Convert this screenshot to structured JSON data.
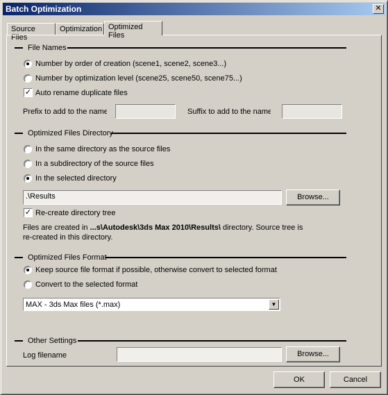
{
  "window": {
    "title": "Batch Optimization",
    "close_glyph": "✕"
  },
  "tabs": [
    {
      "label": "Source Files"
    },
    {
      "label": "Optimization"
    },
    {
      "label": "Optimized Files"
    }
  ],
  "file_names": {
    "heading": "File Names",
    "radio_creation": "Number by order of creation (scene1, scene2, scene3...)",
    "radio_level": "Number by optimization level (scene25, scene50, scene75...)",
    "auto_rename": "Auto rename duplicate files",
    "prefix_label": "Prefix to add to the name",
    "prefix_value": "",
    "suffix_label": "Suffix to add to the name",
    "suffix_value": ""
  },
  "directory": {
    "heading": "Optimized Files Directory",
    "radio_same": "In the same directory as the source files",
    "radio_sub": "In a subdirectory of the source files",
    "radio_selected": "In the selected directory",
    "path_value": ".\\Results",
    "browse_label": "Browse...",
    "recreate": "Re-create directory tree",
    "info_prefix": "Files are created in ",
    "info_path": "...s\\Autodesk\\3ds Max 2010\\Results\\",
    "info_suffix": " directory. Source tree is",
    "info_line2": "re-created in this directory."
  },
  "format": {
    "heading": "Optimized Files Format",
    "radio_keep": "Keep source file format if possible, otherwise convert to selected format",
    "radio_convert": "Convert to the selected format",
    "selected": "MAX - 3ds Max files (*.max)"
  },
  "other": {
    "heading": "Other Settings",
    "log_label": "Log filename",
    "log_value": "",
    "browse_label": "Browse..."
  },
  "footer": {
    "ok": "OK",
    "cancel": "Cancel"
  },
  "icons": {
    "check": "✓",
    "dropdown": "▼"
  }
}
